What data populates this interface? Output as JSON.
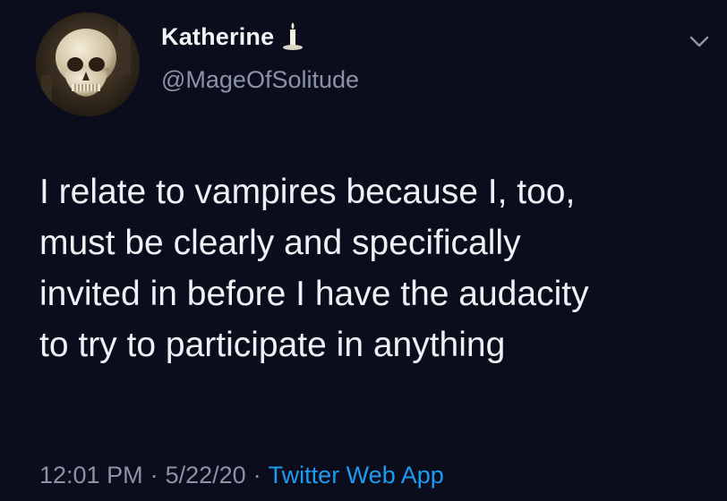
{
  "author": {
    "display_name": "Katherine",
    "handle": "@MageOfSolitude",
    "avatar_icon": "skull-avatar",
    "badge_icon": "candle-icon"
  },
  "menu": {
    "icon": "chevron-down-icon"
  },
  "tweet": {
    "lines": [
      "I relate to vampires because I, too,",
      "must be clearly and specifically",
      "invited in before I have the audacity",
      "to try to participate in anything"
    ]
  },
  "meta": {
    "time": "12:01 PM",
    "separator": "·",
    "date": "5/22/20",
    "source": "Twitter Web App"
  },
  "colors": {
    "background": "#0b0d1c",
    "text": "#eef0f5",
    "secondary": "#8a93a6",
    "link": "#1d9bf0"
  }
}
